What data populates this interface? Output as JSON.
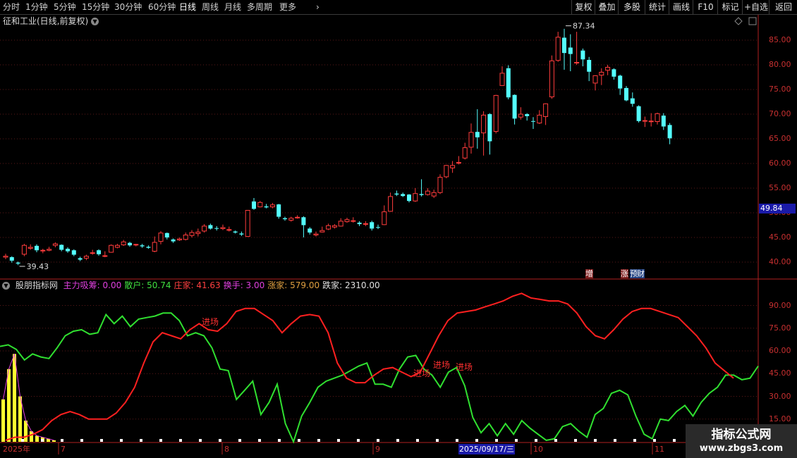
{
  "toolbar": {
    "periods": [
      "分时",
      "1分钟",
      "5分钟",
      "15分钟",
      "30分钟",
      "60分钟",
      "日线",
      "周线",
      "月线",
      "多周期",
      "更多"
    ],
    "active_period": "日线",
    "more_icon": "chevron-right-icon",
    "right_buttons": [
      "复权",
      "叠加",
      "多股",
      "统计",
      "画线",
      "F10",
      "标记",
      "+自选",
      "返回"
    ]
  },
  "stock": {
    "title": "征和工业(日线,前复权)",
    "title_icon": "chevron-down-icon"
  },
  "price_axis": [
    "85.00",
    "80.00",
    "75.00",
    "70.00",
    "65.00",
    "60.00",
    "55.00",
    "50.00",
    "45.00",
    "40.00"
  ],
  "current_price": "49.84",
  "high_annotation": "87.34",
  "low_annotation": "39.43",
  "event_tags": [
    "增",
    "涨",
    "预",
    "财"
  ],
  "indicator": {
    "name": "股朋指标网",
    "items": [
      {
        "label": "主力吸筹: 0.00",
        "color": "#e040e0"
      },
      {
        "label": "散户: 50.74",
        "color": "#40e040"
      },
      {
        "label": "庄家: 41.63",
        "color": "#ff4040"
      },
      {
        "label": "换手: 3.00",
        "color": "#e040e0"
      },
      {
        "label": "涨家: 579.00",
        "color": "#e0a040"
      },
      {
        "label": "跌家: 2310.00",
        "color": "#e0e0e0"
      }
    ],
    "axis": [
      "90.00",
      "75.00",
      "60.00",
      "45.00",
      "30.00",
      "15.00"
    ],
    "signal_label": "进场"
  },
  "dates": [
    "2025年",
    "7",
    "8",
    "9",
    "10",
    "11"
  ],
  "selected_date": "2025/09/17/三",
  "watermark": {
    "title": "指标公式网",
    "url": "www.zbgs3.com"
  },
  "colors": {
    "up": "#ff3c3c",
    "down": "#54ffff",
    "green_line": "#30e030",
    "red_line": "#ff2020",
    "yellow_bar": "#ffff30"
  },
  "candles": [
    [
      41.0,
      41.2,
      41.7,
      40.6
    ],
    [
      41.0,
      40.3,
      41.2,
      39.9
    ],
    [
      39.9,
      39.7,
      40.1,
      39.4
    ],
    [
      41.6,
      43.4,
      43.7,
      41.2
    ],
    [
      42.8,
      43.0,
      43.6,
      42.5
    ],
    [
      43.3,
      42.4,
      43.6,
      42.0
    ],
    [
      42.3,
      42.4,
      42.7,
      41.8
    ],
    [
      42.4,
      42.6,
      43.1,
      42.2
    ],
    [
      43.4,
      43.7,
      44.0,
      43.0
    ],
    [
      43.5,
      42.5,
      43.6,
      42.2
    ],
    [
      42.7,
      42.2,
      43.0,
      41.9
    ],
    [
      42.4,
      41.5,
      42.6,
      41.2
    ],
    [
      40.8,
      40.5,
      41.1,
      40.2
    ],
    [
      40.8,
      41.2,
      41.5,
      40.4
    ],
    [
      41.8,
      41.9,
      42.5,
      41.5
    ],
    [
      42.4,
      41.6,
      42.6,
      41.3
    ],
    [
      41.2,
      41.3,
      42.2,
      41.0
    ],
    [
      42.0,
      43.4,
      43.6,
      41.9
    ],
    [
      43.0,
      43.4,
      43.7,
      42.8
    ],
    [
      43.5,
      44.1,
      44.5,
      43.3
    ],
    [
      43.9,
      43.4,
      44.1,
      43.1
    ],
    [
      43.5,
      43.6,
      43.7,
      43.2
    ],
    [
      43.4,
      43.2,
      43.7,
      42.9
    ],
    [
      43.1,
      42.9,
      43.4,
      42.7
    ],
    [
      42.2,
      44.0,
      45.2,
      42.0
    ],
    [
      44.2,
      45.9,
      46.3,
      43.6
    ],
    [
      45.9,
      45.0,
      46.0,
      44.6
    ],
    [
      44.6,
      44.2,
      44.8,
      43.9
    ],
    [
      44.5,
      44.7,
      45.0,
      44.3
    ],
    [
      44.6,
      45.5,
      46.0,
      44.4
    ],
    [
      45.4,
      46.0,
      46.5,
      45.0
    ],
    [
      45.8,
      46.1,
      46.8,
      45.2
    ],
    [
      46.3,
      47.3,
      47.7,
      46.0
    ],
    [
      47.5,
      46.8,
      47.8,
      46.6
    ],
    [
      46.9,
      46.8,
      47.3,
      46.4
    ],
    [
      46.8,
      47.0,
      47.6,
      46.5
    ],
    [
      46.6,
      46.6,
      47.2,
      46.2
    ],
    [
      46.2,
      46.0,
      46.4,
      45.8
    ],
    [
      45.8,
      45.6,
      46.2,
      45.3
    ],
    [
      45.2,
      50.5,
      50.5,
      45.1
    ],
    [
      52.3,
      50.8,
      53.0,
      50.6
    ],
    [
      51.2,
      52.1,
      52.4,
      51.1
    ],
    [
      51.3,
      51.1,
      51.8,
      50.9
    ],
    [
      51.2,
      51.6,
      52.0,
      50.9
    ],
    [
      51.7,
      49.2,
      51.8,
      48.8
    ],
    [
      48.9,
      48.7,
      49.2,
      48.4
    ],
    [
      48.5,
      48.9,
      49.2,
      48.2
    ],
    [
      49.0,
      49.1,
      49.5,
      48.8
    ],
    [
      49.1,
      47.5,
      49.3,
      45.0
    ],
    [
      46.8,
      46.0,
      47.1,
      45.6
    ],
    [
      45.5,
      45.7,
      46.2,
      45.2
    ],
    [
      46.1,
      46.4,
      47.2,
      46.0
    ],
    [
      46.7,
      47.4,
      47.8,
      46.5
    ],
    [
      47.1,
      47.4,
      47.7,
      46.8
    ],
    [
      47.3,
      48.3,
      48.9,
      47.2
    ],
    [
      48.2,
      48.6,
      49.0,
      48.0
    ],
    [
      48.3,
      48.4,
      49.1,
      48.0
    ],
    [
      48.0,
      47.7,
      48.3,
      47.3
    ],
    [
      47.8,
      47.8,
      48.3,
      47.3
    ],
    [
      48.1,
      46.8,
      48.4,
      46.4
    ],
    [
      47.1,
      47.0,
      47.6,
      46.7
    ],
    [
      47.6,
      50.2,
      51.5,
      47.5
    ],
    [
      50.3,
      53.3,
      54.1,
      50.2
    ],
    [
      53.9,
      53.7,
      54.5,
      53.4
    ],
    [
      53.8,
      53.4,
      54.1,
      53.2
    ],
    [
      53.7,
      52.4,
      53.8,
      52.1
    ],
    [
      52.4,
      53.9,
      55.0,
      52.2
    ],
    [
      53.8,
      53.6,
      56.8,
      53.3
    ],
    [
      53.7,
      54.4,
      55.0,
      53.5
    ],
    [
      53.4,
      54.1,
      54.7,
      53.0
    ],
    [
      54.1,
      57.2,
      57.8,
      53.8
    ],
    [
      57.3,
      59.6,
      59.7,
      57.0
    ],
    [
      59.1,
      59.6,
      60.5,
      58.1
    ],
    [
      60.1,
      60.2,
      61.5,
      59.8
    ],
    [
      61.1,
      63.2,
      64.2,
      60.8
    ],
    [
      63.3,
      66.3,
      68.1,
      62.0
    ],
    [
      66.4,
      65.3,
      71.0,
      63.0
    ],
    [
      66.2,
      69.8,
      70.6,
      61.6
    ],
    [
      70.0,
      64.5,
      70.2,
      61.8
    ],
    [
      66.5,
      73.8,
      73.9,
      66.1
    ],
    [
      75.8,
      78.3,
      79.7,
      75.8
    ],
    [
      79.3,
      73.4,
      79.9,
      73.0
    ],
    [
      73.9,
      69.1,
      74.0,
      67.9
    ],
    [
      69.4,
      70.0,
      71.4,
      68.9
    ],
    [
      70.0,
      69.6,
      70.2,
      68.7
    ],
    [
      68.6,
      68.5,
      69.4,
      67.0
    ],
    [
      68.2,
      69.8,
      70.8,
      68.0
    ],
    [
      69.5,
      72.1,
      72.2,
      67.8
    ],
    [
      73.5,
      80.8,
      81.9,
      73.1
    ],
    [
      80.9,
      85.6,
      86.7,
      80.6
    ],
    [
      85.5,
      82.4,
      87.3,
      79.0
    ],
    [
      83.5,
      82.2,
      86.2,
      78.7
    ],
    [
      80.5,
      80.5,
      86.7,
      80.0
    ],
    [
      82.9,
      81.1,
      83.3,
      79.7
    ],
    [
      81.0,
      78.6,
      81.6,
      76.7
    ],
    [
      76.3,
      77.8,
      77.9,
      74.8
    ],
    [
      77.9,
      78.5,
      79.3,
      75.9
    ],
    [
      78.9,
      79.5,
      80.0,
      77.9
    ],
    [
      79.1,
      77.6,
      79.3,
      77.0
    ],
    [
      77.8,
      75.2,
      78.0,
      73.9
    ],
    [
      75.3,
      72.8,
      75.7,
      72.6
    ],
    [
      73.2,
      72.1,
      74.4,
      71.5
    ],
    [
      71.6,
      68.6,
      71.8,
      68.3
    ],
    [
      68.6,
      68.7,
      69.5,
      67.4
    ],
    [
      68.5,
      68.6,
      70.2,
      67.5
    ],
    [
      68.5,
      70.1,
      70.3,
      67.9
    ],
    [
      69.7,
      67.5,
      70.2,
      66.8
    ],
    [
      67.8,
      65.1,
      68.2,
      63.9
    ]
  ],
  "green_line": [
    63,
    64,
    61,
    54,
    58,
    56,
    55,
    62,
    70,
    73,
    74,
    71,
    72,
    84,
    78,
    83,
    76,
    81,
    82,
    83,
    85,
    85,
    80,
    70,
    72,
    70,
    62,
    48,
    47,
    28,
    34,
    40,
    18,
    26,
    38,
    12,
    0,
    17,
    26,
    36,
    40,
    42,
    44,
    47,
    50,
    52,
    38,
    38,
    36,
    48,
    56,
    57,
    48,
    44,
    36,
    46,
    49,
    37,
    16,
    6,
    12,
    4,
    12,
    5,
    14,
    9,
    5,
    1,
    2,
    10,
    12,
    7,
    3,
    18,
    22,
    32,
    34,
    31,
    17,
    5,
    2,
    15,
    14,
    20,
    24,
    17,
    26,
    32,
    36,
    44,
    44,
    41,
    42,
    50
  ],
  "red_line": [
    1,
    3,
    3,
    5,
    8,
    14,
    18,
    20,
    18,
    15,
    15,
    15,
    19,
    26,
    36,
    52,
    66,
    72,
    70,
    68,
    74,
    78,
    74,
    73,
    78,
    86,
    88,
    88,
    84,
    80,
    72,
    78,
    83,
    84,
    83,
    72,
    52,
    42,
    39,
    39,
    44,
    48,
    49,
    46,
    43,
    46,
    58,
    70,
    80,
    85,
    86,
    87,
    89,
    91,
    93,
    96,
    98,
    95,
    94,
    93,
    93,
    91,
    85,
    76,
    70,
    68,
    74,
    81,
    86,
    88,
    88,
    86,
    84,
    82,
    76,
    70,
    62,
    52,
    47,
    42
  ],
  "volume_bars": [
    28,
    48,
    58,
    30,
    14,
    7,
    4,
    3,
    2,
    1
  ]
}
